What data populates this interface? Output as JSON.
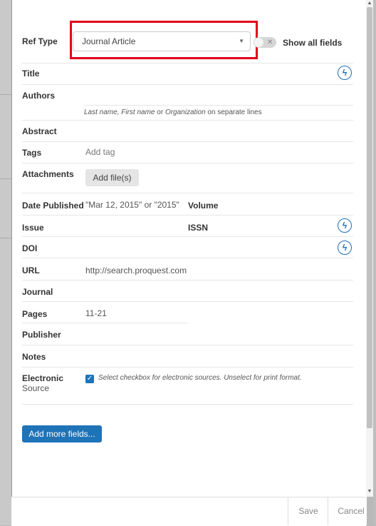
{
  "form": {
    "ref_type": {
      "label": "Ref Type",
      "value": "Journal Article"
    },
    "show_all_fields": "Show all fields",
    "title_label": "Title",
    "authors": {
      "label": "Authors",
      "hint_last": "Last name, First name",
      "hint_or": " or ",
      "hint_org": "Organization",
      "hint_tail": " on separate lines"
    },
    "abstract_label": "Abstract",
    "tags": {
      "label": "Tags",
      "placeholder": "Add tag"
    },
    "attachments": {
      "label": "Attachments",
      "button": "Add file(s)"
    },
    "date_published": {
      "label": "Date Published",
      "placeholder": "\"Mar 12, 2015\" or \"2015\""
    },
    "volume_label": "Volume",
    "issue_label": "Issue",
    "issn_label": "ISSN",
    "doi_label": "DOI",
    "url": {
      "label": "URL",
      "value": "http://search.proquest.com"
    },
    "journal_label": "Journal",
    "pages": {
      "label": "Pages",
      "value": "11-21"
    },
    "publisher_label": "Publisher",
    "notes_label": "Notes",
    "electronic_source": {
      "label_line1": "Electronic",
      "label_line2": "Source",
      "checked": true,
      "hint": "Select checkbox for electronic sources. Unselect for print format."
    },
    "add_more_button": "Add more fields..."
  },
  "footer": {
    "save": "Save",
    "cancel": "Cancel"
  },
  "icons": {
    "bolt": "lightning-bolt-icon",
    "checkmark": "checkmark-icon",
    "dropdown": "chevron-down-icon",
    "toggle_x": "close-icon"
  },
  "colors": {
    "accent": "#1f73b7",
    "highlight": "#e0001b"
  }
}
